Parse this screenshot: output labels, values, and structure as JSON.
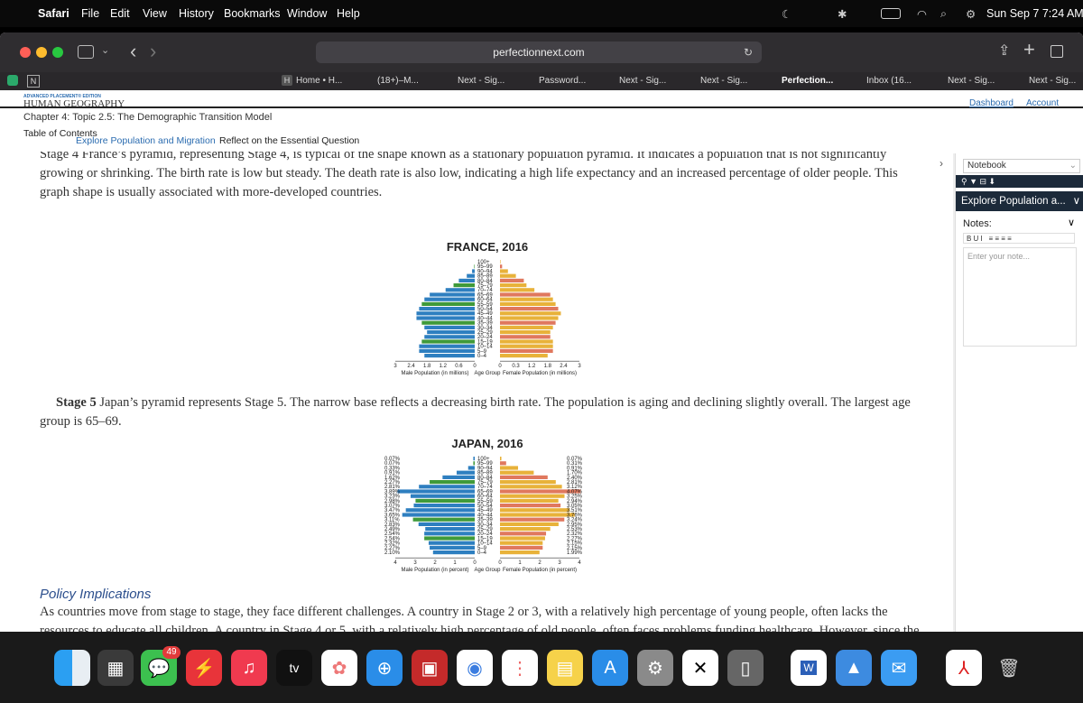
{
  "menubar": {
    "apple": "",
    "app": "Safari",
    "items": [
      "File",
      "Edit",
      "View",
      "History",
      "Bookmarks",
      "Window",
      "Help"
    ],
    "clock": "Sun Sep 7  7:24 AM"
  },
  "browser": {
    "url": "perfectionnext.com",
    "bookmarks": [
      "Home • H...",
      "(18+)–M...",
      "Next - Sig...",
      "Password...",
      "Next - Sig...",
      "Next - Sig...",
      "Perfection...",
      "Inbox (16...",
      "Next - Sig...",
      "Next - Sig..."
    ]
  },
  "header": {
    "edition": "ADVANCED PLACEMENT® EDITION",
    "course": "HUMAN GEOGRAPHY",
    "chapter": "Chapter 4: Topic 2.5: The Demographic Transition Model",
    "dashboard": "Dashboard",
    "account": "Account",
    "toc": "Table of Contents",
    "tab1": "Explore Population and Migration",
    "tab2": "Reflect on the Essential Question"
  },
  "content": {
    "para1": "Stage 4 France’s pyramid, representing Stage 4, is typical of the shape known as a stationary population pyramid. It indicates a population that is not significantly growing or shrinking. The birth rate is low but steady. The death rate is also low, indicating a high life expectancy and an increased percentage of older people. This graph shape is usually associated with more-developed countries.",
    "stage5_bold": "Stage 5",
    "stage5_text": " Japan’s pyramid represents Stage 5. The narrow base reflects a decreasing birth rate. The population is aging and declining slightly overall. The largest age group is 65–69.",
    "policy_title": "Policy Implications",
    "policy_text": "As countries move from stage to stage, they face different challenges. A country in Stage 2 or 3, with a relatively high percentage of young people, often lacks the resources to educate all children. A country in Stage 4 or 5, with a relatively high percentage of old people, often faces problems funding healthcare. However, since the elderly can vote while children cannot, the elderly often have more political influence."
  },
  "sidebar": {
    "notebook": "Notebook",
    "section": "Explore Population a...",
    "notes_label": "Notes:",
    "placeholder": "Enter your note..."
  },
  "chart_data": [
    {
      "type": "bar",
      "title": "FRANCE, 2016",
      "age_groups": [
        "100+",
        "95–99",
        "90–94",
        "85–89",
        "80–84",
        "75–79",
        "70–74",
        "65–69",
        "60–64",
        "55–59",
        "50–54",
        "45–49",
        "40–44",
        "35–39",
        "30–34",
        "25–29",
        "20–24",
        "15–19",
        "10–14",
        "5–9",
        "0–4"
      ],
      "series": [
        {
          "name": "Male Population (in millions)",
          "values": [
            0.0,
            0.02,
            0.1,
            0.3,
            0.6,
            0.8,
            1.1,
            1.7,
            1.9,
            2.0,
            2.1,
            2.2,
            2.2,
            2.0,
            1.9,
            1.8,
            1.9,
            2.0,
            2.1,
            2.1,
            1.9
          ]
        },
        {
          "name": "Female Population (in millions)",
          "values": [
            0.02,
            0.08,
            0.3,
            0.6,
            0.9,
            1.0,
            1.3,
            1.9,
            2.0,
            2.1,
            2.2,
            2.3,
            2.2,
            2.1,
            2.0,
            1.9,
            1.9,
            2.0,
            2.0,
            2.0,
            1.8
          ]
        }
      ],
      "x_ticks_left": [
        "3",
        "2.4",
        "1.8",
        "1.2",
        "0.6",
        "0"
      ],
      "x_ticks_right": [
        "0",
        "0.3",
        "1.2",
        "1.8",
        "2.4",
        "3"
      ],
      "xlabel_left": "Male Population (in millions)",
      "xlabel_center": "Age Group",
      "xlabel_right": "Female Population (in millions)",
      "xlim": [
        0,
        3
      ]
    },
    {
      "type": "bar",
      "title": "JAPAN, 2016",
      "age_groups": [
        "100+",
        "95–99",
        "90–94",
        "85–89",
        "80–84",
        "75–79",
        "70–74",
        "65–69",
        "60–64",
        "55–59",
        "50–54",
        "45–49",
        "40–44",
        "35–39",
        "30–34",
        "25–29",
        "20–24",
        "15–19",
        "10–14",
        "5–9",
        "0–4"
      ],
      "male_labels": [
        "0.07%",
        "0.07%",
        "0.33%",
        "0.91%",
        "1.62%",
        "2.27%",
        "2.81%",
        "3.89%",
        "3.23%",
        "2.98%",
        "3.07%",
        "3.47%",
        "3.65%",
        "3.11%",
        "2.83%",
        "2.49%",
        "2.54%",
        "2.54%",
        "2.32%",
        "2.27%",
        "2.10%"
      ],
      "female_labels": [
        "0.07%",
        "0.31%",
        "0.91%",
        "1.70%",
        "2.40%",
        "2.81%",
        "3.12%",
        "4.07%",
        "3.25%",
        "2.94%",
        "3.05%",
        "3.51%",
        "3.76%",
        "3.24%",
        "2.95%",
        "2.53%",
        "2.32%",
        "2.27%",
        "2.15%",
        "2.15%",
        "1.99%"
      ],
      "series": [
        {
          "name": "Male Population (in percent)",
          "values": [
            0.07,
            0.07,
            0.33,
            0.91,
            1.62,
            2.27,
            2.81,
            3.89,
            3.23,
            2.98,
            3.07,
            3.47,
            3.65,
            3.11,
            2.83,
            2.49,
            2.54,
            2.54,
            2.32,
            2.27,
            2.1
          ]
        },
        {
          "name": "Female Population (in percent)",
          "values": [
            0.07,
            0.31,
            0.91,
            1.7,
            2.4,
            2.81,
            3.12,
            4.07,
            3.25,
            2.94,
            3.05,
            3.51,
            3.76,
            3.24,
            2.95,
            2.53,
            2.32,
            2.27,
            2.15,
            2.15,
            1.99
          ]
        }
      ],
      "x_ticks_left": [
        "4",
        "3",
        "2",
        "1",
        "0"
      ],
      "x_ticks_right": [
        "0",
        "1",
        "2",
        "3",
        "4"
      ],
      "xlabel_left": "Male Population (in percent)",
      "xlabel_center": "Age Group",
      "xlabel_right": "Female Population (in percent)",
      "xlim": [
        0,
        4
      ]
    }
  ],
  "dock": {
    "badge": "49",
    "apps": [
      "finder",
      "launchpad",
      "messages",
      "spark",
      "music",
      "apple-tv",
      "photos",
      "safari",
      "photo-booth",
      "chrome",
      "reminders",
      "notes",
      "app-store",
      "system-settings",
      "capcut",
      "iphone-mirroring",
      "word",
      "keynote",
      "mail",
      "acrobat",
      "trash"
    ],
    "tv_label": "tv",
    "word_label": "W"
  },
  "colors": {
    "male": "#2e7fc0",
    "male_alt": "#3f9a3a",
    "female": "#e8b23a",
    "female_alt": "#e0785e",
    "link": "#2b6cb0"
  }
}
